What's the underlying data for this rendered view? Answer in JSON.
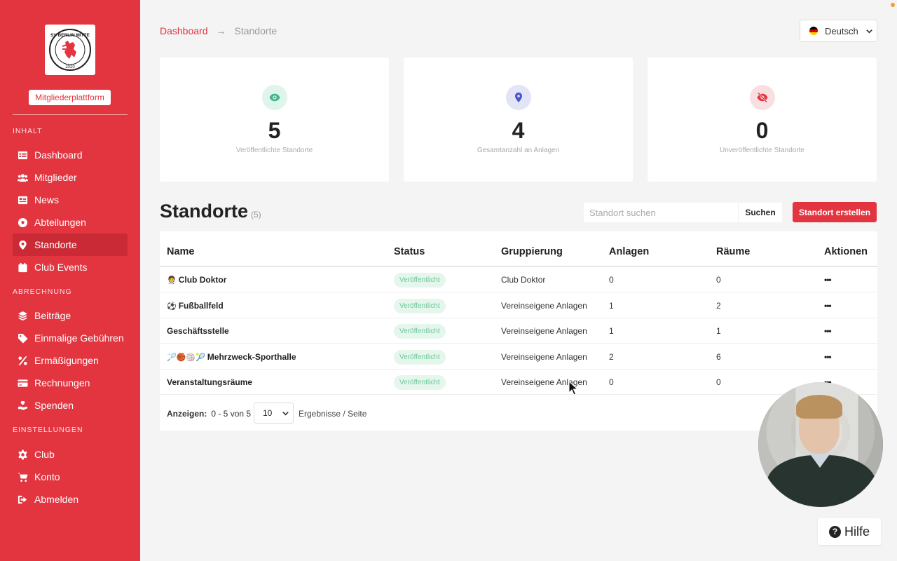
{
  "sidebar": {
    "platform_label": "Mitgliederplattform",
    "sections": [
      "INHALT",
      "ABRECHNUNG",
      "EINSTELLUNGEN"
    ],
    "items": [
      {
        "label": "Dashboard",
        "icon": "table-icon"
      },
      {
        "label": "Mitglieder",
        "icon": "users-icon"
      },
      {
        "label": "News",
        "icon": "newspaper-icon"
      },
      {
        "label": "Abteilungen",
        "icon": "soccer-ball-icon"
      },
      {
        "label": "Standorte",
        "icon": "map-pin-icon",
        "active": true
      },
      {
        "label": "Club Events",
        "icon": "calendar-icon"
      },
      {
        "label": "Beiträge",
        "icon": "layers-icon"
      },
      {
        "label": "Einmalige Gebühren",
        "icon": "tag-icon"
      },
      {
        "label": "Ermäßigungen",
        "icon": "percent-icon"
      },
      {
        "label": "Rechnungen",
        "icon": "credit-card-icon"
      },
      {
        "label": "Spenden",
        "icon": "hand-holding-icon"
      },
      {
        "label": "Club",
        "icon": "gear-icon"
      },
      {
        "label": "Konto",
        "icon": "cart-icon"
      },
      {
        "label": "Abmelden",
        "icon": "sign-out-icon"
      }
    ]
  },
  "breadcrumb": {
    "parent": "Dashboard",
    "arrow": "→",
    "current": "Standorte"
  },
  "language": {
    "label": "Deutsch"
  },
  "stats": [
    {
      "value": "5",
      "label": "Veröffentlichte Standorte",
      "icon": "eye-icon",
      "color": "#3fb58a"
    },
    {
      "value": "4",
      "label": "Gesamtanzahl an Anlagen",
      "icon": "map-pin-icon",
      "color": "#4a55c9"
    },
    {
      "value": "0",
      "label": "Unveröffentlichte Standorte",
      "icon": "eye-slash-icon",
      "color": "#e23540"
    }
  ],
  "page": {
    "title": "Standorte",
    "count": "(5)"
  },
  "search": {
    "placeholder": "Standort suchen",
    "button": "Suchen"
  },
  "create_button": "Standort erstellen",
  "table": {
    "headers": [
      "Name",
      "Status",
      "Gruppierung",
      "Anlagen",
      "Räume",
      "Aktionen"
    ],
    "rows": [
      {
        "emoji": "🧑‍⚕️",
        "name": "Club Doktor",
        "status": "Veröffentlicht",
        "group": "Club Doktor",
        "anlagen": "0",
        "raeume": "0"
      },
      {
        "emoji": "⚽",
        "name": "Fußballfeld",
        "status": "Veröffentlicht",
        "group": "Vereinseigene Anlagen",
        "anlagen": "1",
        "raeume": "2"
      },
      {
        "emoji": "",
        "name": "Geschäftsstelle",
        "status": "Veröffentlicht",
        "group": "Vereinseigene Anlagen",
        "anlagen": "1",
        "raeume": "1"
      },
      {
        "emoji": "🏸🏀🏐🎾",
        "name": "Mehrzweck-Sporthalle",
        "status": "Veröffentlicht",
        "group": "Vereinseigene Anlagen",
        "anlagen": "2",
        "raeume": "6"
      },
      {
        "emoji": "",
        "name": "Veranstaltungsräume",
        "status": "Veröffentlicht",
        "group": "Vereinseigene Anlagen",
        "anlagen": "0",
        "raeume": "0"
      }
    ],
    "actions_glyph": "•••"
  },
  "pagination": {
    "label": "Anzeigen:",
    "range": "0 - 5 von 5",
    "per_page": "10",
    "per_page_label": "Ergebnisse / Seite"
  },
  "help": {
    "label": "Hilfe",
    "glyph": "?"
  }
}
